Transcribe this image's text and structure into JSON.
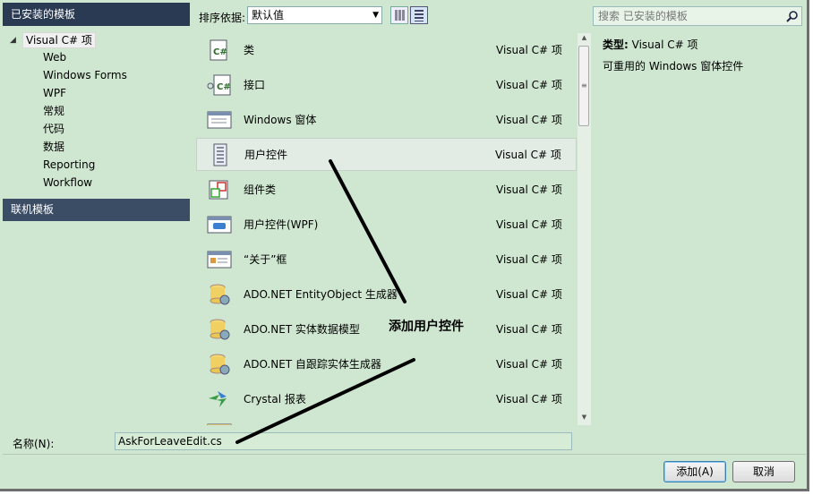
{
  "left_panel": {
    "header": "已安装的模板",
    "root": "Visual C# 项",
    "items": [
      "Web",
      "Windows Forms",
      "WPF",
      "常规",
      "代码",
      "数据",
      "Reporting",
      "Workflow"
    ],
    "online": "联机模板"
  },
  "toolbar": {
    "sort_label": "排序依据:",
    "sort_value": "默认值",
    "search_placeholder": "搜索 已安装的模板"
  },
  "templates": [
    {
      "name": "类",
      "lang": "Visual C# 项",
      "icon": "class-icon"
    },
    {
      "name": "接口",
      "lang": "Visual C# 项",
      "icon": "interface-icon"
    },
    {
      "name": "Windows 窗体",
      "lang": "Visual C# 项",
      "icon": "windows-form-icon"
    },
    {
      "name": "用户控件",
      "lang": "Visual C# 项",
      "icon": "user-control-icon"
    },
    {
      "name": "组件类",
      "lang": "Visual C# 项",
      "icon": "component-class-icon"
    },
    {
      "name": "用户控件(WPF)",
      "lang": "Visual C# 项",
      "icon": "wpf-user-control-icon"
    },
    {
      "name": "“关于”框",
      "lang": "Visual C# 项",
      "icon": "about-box-icon"
    },
    {
      "name": "ADO.NET EntityObject 生成器",
      "lang": "Visual C# 项",
      "icon": "database-icon"
    },
    {
      "name": "ADO.NET 实体数据模型",
      "lang": "Visual C# 项",
      "icon": "database-icon"
    },
    {
      "name": "ADO.NET 自跟踪实体生成器",
      "lang": "Visual C# 项",
      "icon": "database-icon"
    },
    {
      "name": "Crystal 报表",
      "lang": "Visual C# 项",
      "icon": "crystal-report-icon"
    }
  ],
  "selected_index": 3,
  "details": {
    "type_label": "类型:",
    "type_value": "Visual C# 项",
    "description": "可重用的 Windows 窗体控件"
  },
  "name_field": {
    "label": "名称(N):",
    "value": "AskForLeaveEdit.cs"
  },
  "buttons": {
    "add": "添加(A)",
    "cancel": "取消"
  },
  "annotation": "添加用户控件",
  "colors": {
    "panel_bg": "#cfe7d0",
    "header_bg": "#2a3a52"
  }
}
